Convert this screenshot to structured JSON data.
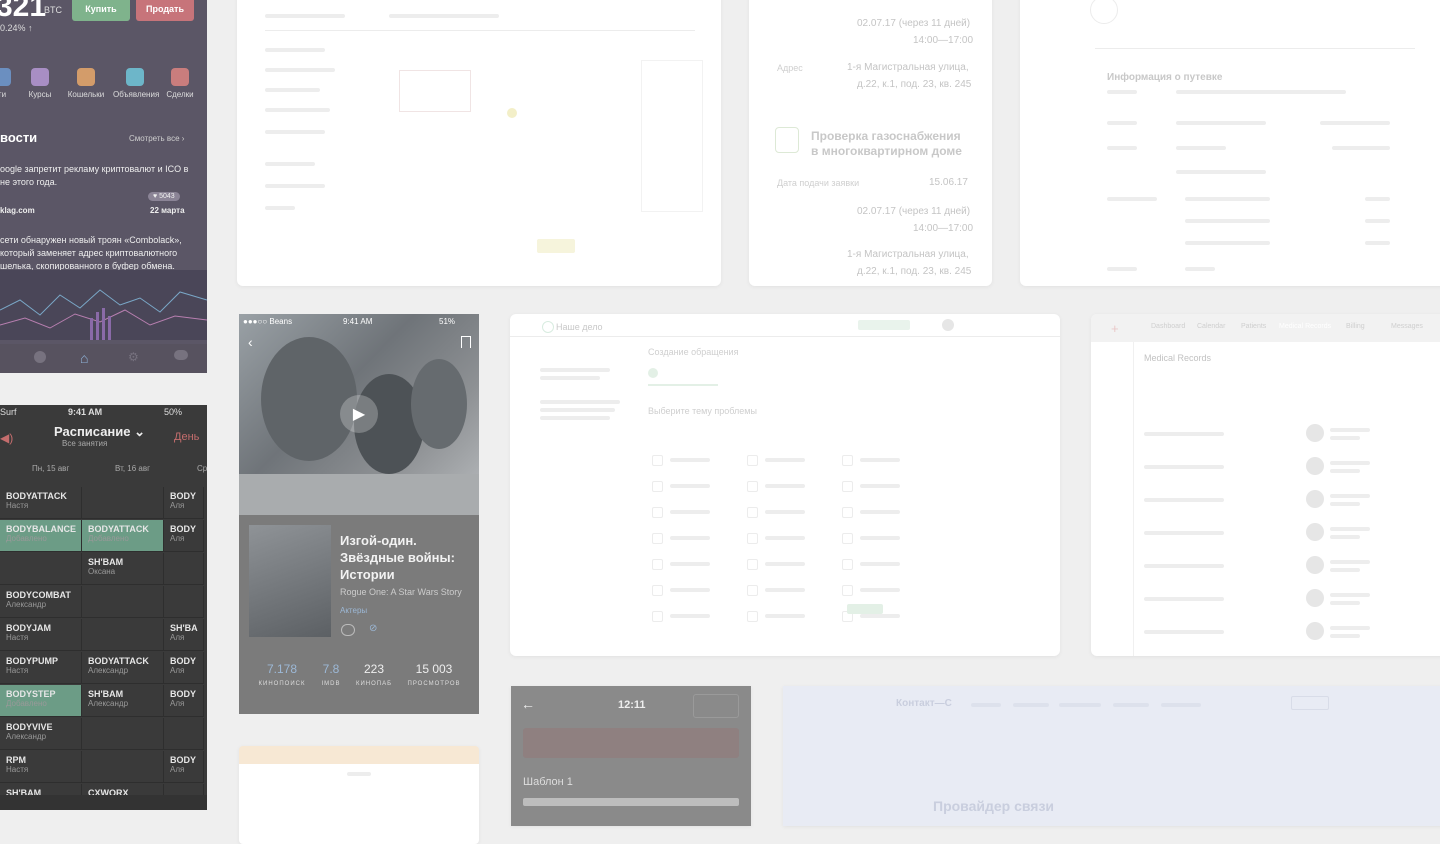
{
  "crypto_app": {
    "price": "321",
    "currency": "BTC",
    "change": "0.24% ↑",
    "buy_label": "Купить",
    "sell_label": "Продать",
    "tabs": [
      "ти",
      "Курсы",
      "Кошельки",
      "Объявления",
      "Сделки"
    ],
    "news_heading": "вости",
    "see_all": "Смотреть все ›",
    "news1_text": "oogle запретит рекламу криптовалют и ICO в\nне этого года.",
    "news1_likes": "♥ 5043",
    "news1_source": "klag.com",
    "news1_date": "22 марта",
    "news2_text": "сети обнаружен новый троян «Combolack»,\nкоторый заменяет адрес криптовалютного\nшелька, скопированного в буфер обмена."
  },
  "schedule_app": {
    "status_carrier": "Surf",
    "status_time": "9:41 AM",
    "status_battery": "50%",
    "title": "Расписание",
    "subtitle": "Все занятия",
    "right_action": "День",
    "days": [
      "Пн, 15 авг",
      "Вт, 16 авг",
      "Ср"
    ],
    "rows": [
      {
        "c1": "BODYATTACK",
        "w1": "Настя",
        "c2": "",
        "w2": "",
        "c3": "BODY",
        "w3": "Аля",
        "hl1": false,
        "hl2": false
      },
      {
        "c1": "BODYBALANCE",
        "w1": "Добавлено",
        "c2": "BODYATTACK",
        "w2": "Добавлено",
        "c3": "BODY",
        "w3": "Аля",
        "hl1": true,
        "hl2": true
      },
      {
        "c1": "",
        "w1": "",
        "c2": "SH'BAM",
        "w2": "Оксана",
        "c3": "",
        "w3": "",
        "hl1": false,
        "hl2": false
      },
      {
        "c1": "BODYCOMBAT",
        "w1": "Александр",
        "c2": "",
        "w2": "",
        "c3": "",
        "w3": "",
        "hl1": false,
        "hl2": false
      },
      {
        "c1": "BODYJAM",
        "w1": "Настя",
        "c2": "",
        "w2": "",
        "c3": "SH'BA",
        "w3": "Аля",
        "hl1": false,
        "hl2": false
      },
      {
        "c1": "BODYPUMP",
        "w1": "Настя",
        "c2": "BODYATTACK",
        "w2": "Александр",
        "c3": "BODY",
        "w3": "Аля",
        "hl1": false,
        "hl2": false
      },
      {
        "c1": "BODYSTEP",
        "w1": "Добавлено",
        "c2": "SH'BAM",
        "w2": "Александр",
        "c3": "BODY",
        "w3": "Аля",
        "hl1": true,
        "hl2": false
      },
      {
        "c1": "BODYVIVE",
        "w1": "Александр",
        "c2": "",
        "w2": "",
        "c3": "",
        "w3": "",
        "hl1": false,
        "hl2": false
      },
      {
        "c1": "RPM",
        "w1": "Настя",
        "c2": "",
        "w2": "",
        "c3": "BODY",
        "w3": "Аля",
        "hl1": false,
        "hl2": false
      },
      {
        "c1": "SH'BAM",
        "w1": "",
        "c2": "CXWORX",
        "w2": "",
        "c3": "",
        "w3": "",
        "hl1": false,
        "hl2": false
      }
    ]
  },
  "movie_app": {
    "status_carrier": "●●●○○ Beans",
    "status_time": "9:41 AM",
    "status_battery": "51%",
    "title": "Изгой-один.\nЗвёздные войны:\nИстории",
    "original_title": "Rogue One: A Star Wars Story",
    "action_link": "Актеры",
    "stats": [
      {
        "value": "7.178",
        "key": "КИНОПОИСК"
      },
      {
        "value": "7.8",
        "key": "IMDB"
      },
      {
        "value": "223",
        "key": "КИНОПАБ"
      },
      {
        "value": "15 003",
        "key": "ПРОСМОТРОВ"
      }
    ]
  },
  "gas_service": {
    "date1": "02.07.17 (через 11 дней)",
    "time1": "14:00—17:00",
    "address_label": "Адрес",
    "address1": "1-я Магистральная улица,",
    "address1b": "д.22, к.1, под. 23, кв. 245",
    "heading": "Проверка газоснабжения\nв многоквартирном доме",
    "date_label": "Дата подачи заявки",
    "date_value": "15.06.17",
    "date2": "02.07.17 (через 11 дней)",
    "time2": "14:00—17:00",
    "address2": "1-я Магистральная улица,",
    "address2b": "д.22, к.1, под. 23, кв. 245"
  },
  "trip_info": {
    "heading": "Информация о путевке"
  },
  "medical": {
    "active_tab": "Medical Records",
    "tabs": [
      "Dashboard",
      "Calendar",
      "Patients",
      "Medical Records",
      "Billing",
      "Messages"
    ],
    "title": "Medical Records"
  },
  "mobile_template": {
    "time": "12:11",
    "template_label": "Шаблон 1"
  },
  "contact": {
    "brand": "Контакт—С",
    "hero": "Провайдер связи"
  },
  "requests": {
    "brand": "Наше дело",
    "section": "Создание обращения",
    "subsection": "Выберите тему проблемы"
  }
}
